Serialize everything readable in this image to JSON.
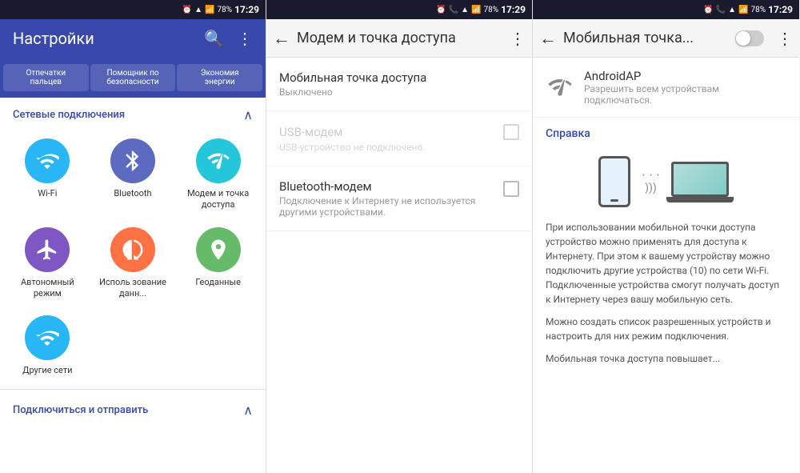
{
  "panel1": {
    "statusBar": {
      "time": "17:29",
      "battery": "78%"
    },
    "topBar": {
      "title": "Настройки",
      "searchLabel": "search",
      "menuLabel": "menu"
    },
    "shortcuts": [
      {
        "label": "Отпечатки\nпальцев"
      },
      {
        "label": "Помощник по\nбезопасности"
      },
      {
        "label": "Экономия\nэнергии"
      }
    ],
    "section1": {
      "title": "Сетевые подключения",
      "items": [
        {
          "id": "wifi",
          "label": "Wi-Fi",
          "color": "#29b6f6",
          "icon": "wifi"
        },
        {
          "id": "bluetooth",
          "label": "Bluetooth",
          "color": "#5c6bc0",
          "icon": "bluetooth"
        },
        {
          "id": "modem",
          "label": "Модем и точка доступа",
          "color": "#26c6da",
          "icon": "hotspot"
        },
        {
          "id": "airplane",
          "label": "Автономный режим",
          "color": "#7e57c2",
          "icon": "airplane"
        },
        {
          "id": "datausage",
          "label": "Исполь зование данн...",
          "color": "#ff7043",
          "icon": "chart"
        },
        {
          "id": "geo",
          "label": "Геоданные",
          "color": "#66bb6a",
          "icon": "location"
        },
        {
          "id": "othernets",
          "label": "Другие сети",
          "color": "#29b6f6",
          "icon": "more-networks"
        }
      ]
    },
    "section2": {
      "title": "Подключиться и отправить"
    }
  },
  "panel2": {
    "statusBar": {
      "time": "17:29",
      "battery": "78%"
    },
    "topBar": {
      "backLabel": "←",
      "title": "Модем и точка доступа",
      "menuLabel": "⋮"
    },
    "items": [
      {
        "id": "hotspot",
        "title": "Мобильная точка доступа",
        "subtitle": "Выключено",
        "hasCheckbox": false,
        "disabled": false
      },
      {
        "id": "usb",
        "title": "USB-модем",
        "subtitle": "USB-устройство не подключено.",
        "hasCheckbox": true,
        "disabled": true
      },
      {
        "id": "btmodem",
        "title": "Bluetooth-модем",
        "subtitle": "Подключение к Интернету не используется другими устройствами.",
        "hasCheckbox": true,
        "disabled": false
      }
    ]
  },
  "panel3": {
    "statusBar": {
      "time": "17:29",
      "battery": "78%"
    },
    "topBar": {
      "backLabel": "←",
      "title": "Мобильная точка...",
      "menuLabel": "⋮"
    },
    "apItem": {
      "name": "AndroidAP",
      "subtitle": "Разрешить всем устройствам подключаться."
    },
    "helpTitle": "Справка",
    "helpParagraphs": [
      "При использовании мобильной точки доступа устройство можно применять для доступа к Интернету. При этом к вашему устройству можно подключить другие устройства (10) по сети Wi-Fi. Подключенные устройства смогут получать доступ к Интернету через вашу мобильную сеть.",
      "Можно создать список разрешенных устройств и настроить для них режим подключения.",
      "Мобильная точка доступа повышает..."
    ]
  }
}
